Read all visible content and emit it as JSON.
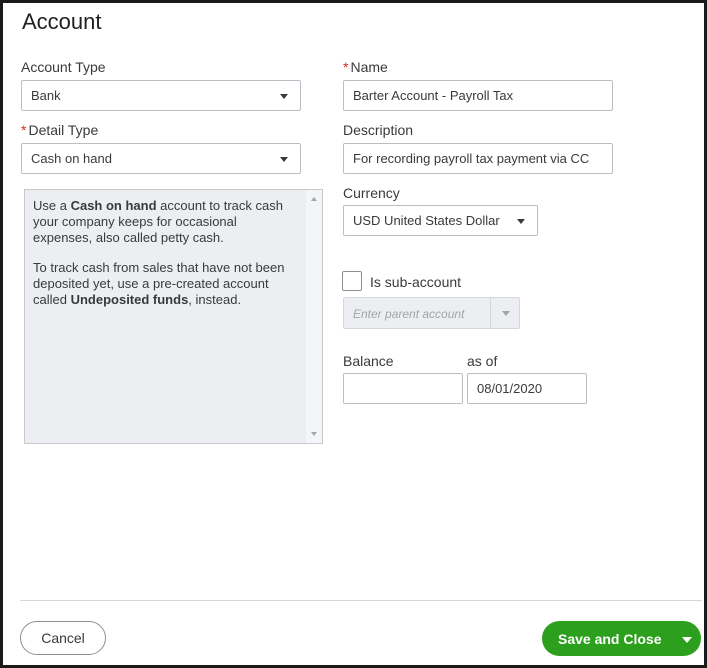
{
  "dialog": {
    "title": "Account"
  },
  "account_type": {
    "label": "Account Type",
    "value": "Bank"
  },
  "detail_type": {
    "required_mark": "*",
    "label": "Detail Type",
    "value": "Cash on hand"
  },
  "info": {
    "p1_a": "Use a ",
    "p1_b": "Cash on hand",
    "p1_c": " account to track cash your company keeps for occasional expenses, also called petty cash.",
    "p2_a": "To track cash from sales that have not been deposited yet, use a pre-created account called ",
    "p2_b": "Undeposited funds",
    "p2_c": ", instead."
  },
  "name": {
    "required_mark": "*",
    "label": "Name",
    "value": "Barter Account - Payroll Tax"
  },
  "description": {
    "label": "Description",
    "value": "For recording payroll tax payment via CC"
  },
  "currency": {
    "label": "Currency",
    "value": "USD United States Dollar"
  },
  "sub_account": {
    "label": "Is sub-account",
    "checked": false,
    "parent_placeholder": "Enter parent account"
  },
  "balance": {
    "label": "Balance",
    "value": "",
    "as_of_label": "as of",
    "as_of_value": "08/01/2020"
  },
  "footer": {
    "cancel_label": "Cancel",
    "save_label": "Save and Close"
  },
  "colors": {
    "primary_green": "#2ca01c",
    "required_red": "#d52b1e",
    "info_bg": "#eceef1"
  }
}
